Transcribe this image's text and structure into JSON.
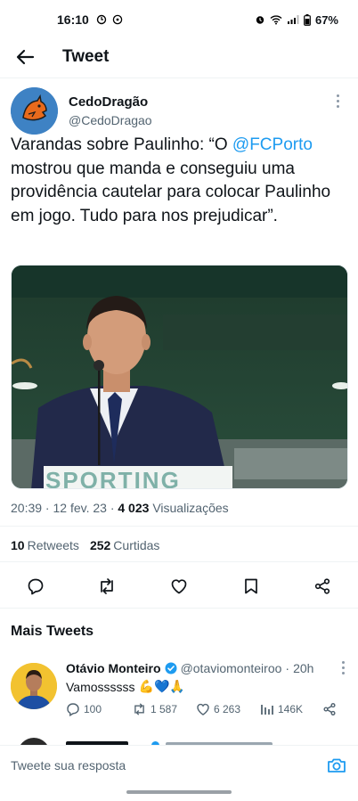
{
  "status_bar": {
    "time": "16:10",
    "battery": "67%"
  },
  "header": {
    "title": "Tweet"
  },
  "tweet": {
    "author_name": "CedoDragão",
    "author_handle": "@CedoDragao",
    "text_before": "Varandas sobre Paulinho: “O ",
    "mention": "@FCPorto",
    "text_after": " mostrou que manda e conseguiu uma providência cautelar para colocar Paulinho em jogo. Tudo para nos prejudicar”.",
    "photo_caption": "SPORTING",
    "timestamp": "20:39 · 12 fev. 23 · ",
    "views_count": "4 023",
    "views_label": "Visualizações",
    "retweets_count": "10",
    "retweets_label": "Retweets",
    "likes_count": "252",
    "likes_label": "Curtidas"
  },
  "more_tweets": {
    "title": "Mais Tweets",
    "items": [
      {
        "author_name": "Otávio Monteiro",
        "author_handle": "@otaviomonteiroo",
        "time": "20h",
        "text": "Vamossssss",
        "emojis": "💪💙🙏",
        "replies": "100",
        "retweets": "1 587",
        "likes": "6 263",
        "views": "146K"
      }
    ]
  },
  "reply": {
    "placeholder": "Tweete sua resposta"
  },
  "colors": {
    "accent": "#1d9bf0",
    "text": "#0f1419",
    "secondary": "#536471"
  }
}
